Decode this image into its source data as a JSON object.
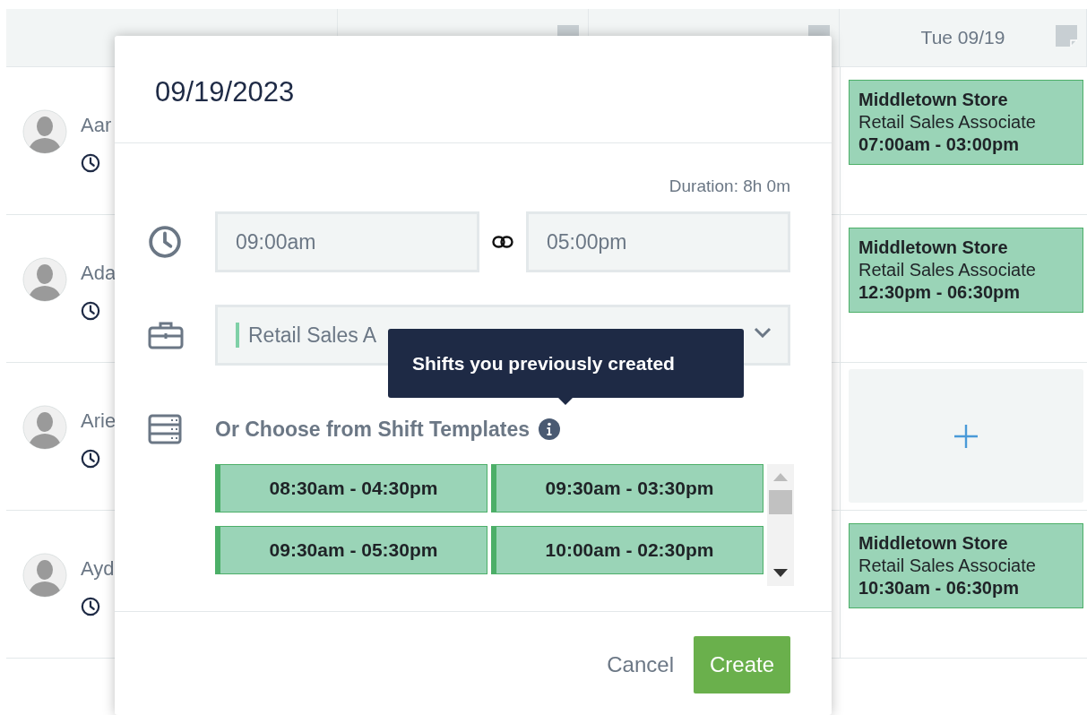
{
  "header": {
    "days": [
      {
        "kind": "covered"
      },
      {
        "kind": "covered"
      },
      {
        "kind": "visible",
        "label": "Tue 09/19"
      }
    ]
  },
  "employees": [
    {
      "name": "Aar",
      "tuesday": {
        "kind": "shift",
        "location": "Middletown Store",
        "role": "Retail Sales Associate",
        "time": "07:00am - 03:00pm"
      }
    },
    {
      "name": "Ada",
      "tuesday": {
        "kind": "shift",
        "location": "Middletown Store",
        "role": "Retail Sales Associate",
        "time": "12:30pm - 06:30pm"
      }
    },
    {
      "name": "Arie",
      "tuesday": {
        "kind": "empty"
      }
    },
    {
      "name": "Ayd",
      "tuesday": {
        "kind": "shift",
        "location": "Middletown Store",
        "role": "Retail Sales Associate",
        "time": "10:30am - 06:30pm"
      }
    }
  ],
  "modal": {
    "title": "09/19/2023",
    "duration": "Duration: 8h 0m",
    "start_time": "09:00am",
    "end_time": "05:00pm",
    "position": "Retail Sales A",
    "templates_label": "Or Choose from Shift Templates",
    "tooltip": "Shifts you previously created",
    "templates": [
      "08:30am - 04:30pm",
      "09:30am - 03:30pm",
      "09:30am - 05:30pm",
      "10:00am - 02:30pm"
    ],
    "buttons": [
      {
        "label": "Cancel",
        "kind": "text"
      },
      {
        "label": "Create",
        "kind": "primary"
      }
    ]
  }
}
